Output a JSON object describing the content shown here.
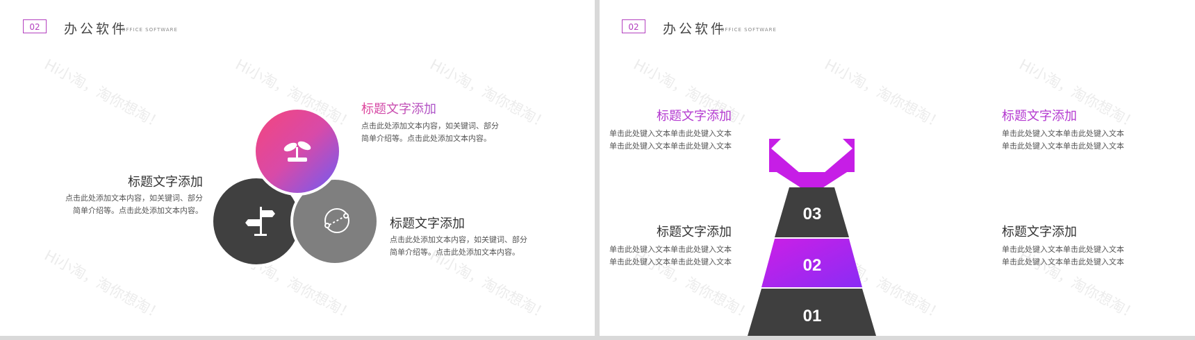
{
  "watermark": "Hi小淘，淘你想淘！",
  "header": {
    "page_number": "02",
    "title": "办公软件",
    "subtitle": "OFFICE SOFTWARE"
  },
  "left_slide": {
    "top_item": {
      "title": "标题文字添加",
      "line1": "点击此处添加文本内容，如关键词、部分",
      "line2": "简单介绍等。点击此处添加文本内容。"
    },
    "left_item": {
      "title": "标题文字添加",
      "line1": "点击此处添加文本内容，如关键词、部分",
      "line2": "简单介绍等。点击此处添加文本内容。"
    },
    "right_item": {
      "title": "标题文字添加",
      "line1": "点击此处添加文本内容，如关键词、部分",
      "line2": "简单介绍等。点击此处添加文本内容。"
    },
    "icons": [
      "sprout-icon",
      "signpost-icon",
      "orbit-icon"
    ]
  },
  "right_slide": {
    "top_left": {
      "title": "标题文字添加",
      "line1": "单击此处键入文本单击此处键入文本",
      "line2": "单击此处键入文本单击此处键入文本"
    },
    "top_right": {
      "title": "标题文字添加",
      "line1": "单击此处键入文本单击此处键入文本",
      "line2": "单击此处键入文本单击此处键入文本"
    },
    "bottom_left": {
      "title": "标题文字添加",
      "line1": "单击此处键入文本单击此处键入文本",
      "line2": "单击此处键入文本单击此处键入文本"
    },
    "bottom_right": {
      "title": "标题文字添加",
      "line1": "单击此处键入文本单击此处键入文本",
      "line2": "单击此处键入文本单击此处键入文本"
    },
    "steps": [
      "03",
      "02",
      "01"
    ]
  },
  "colors": {
    "purple": "#c21fe0",
    "pink": "#f0457f",
    "violet": "#7a5cf5",
    "dark": "#3f3f3f",
    "gray": "#7e7e7e"
  }
}
